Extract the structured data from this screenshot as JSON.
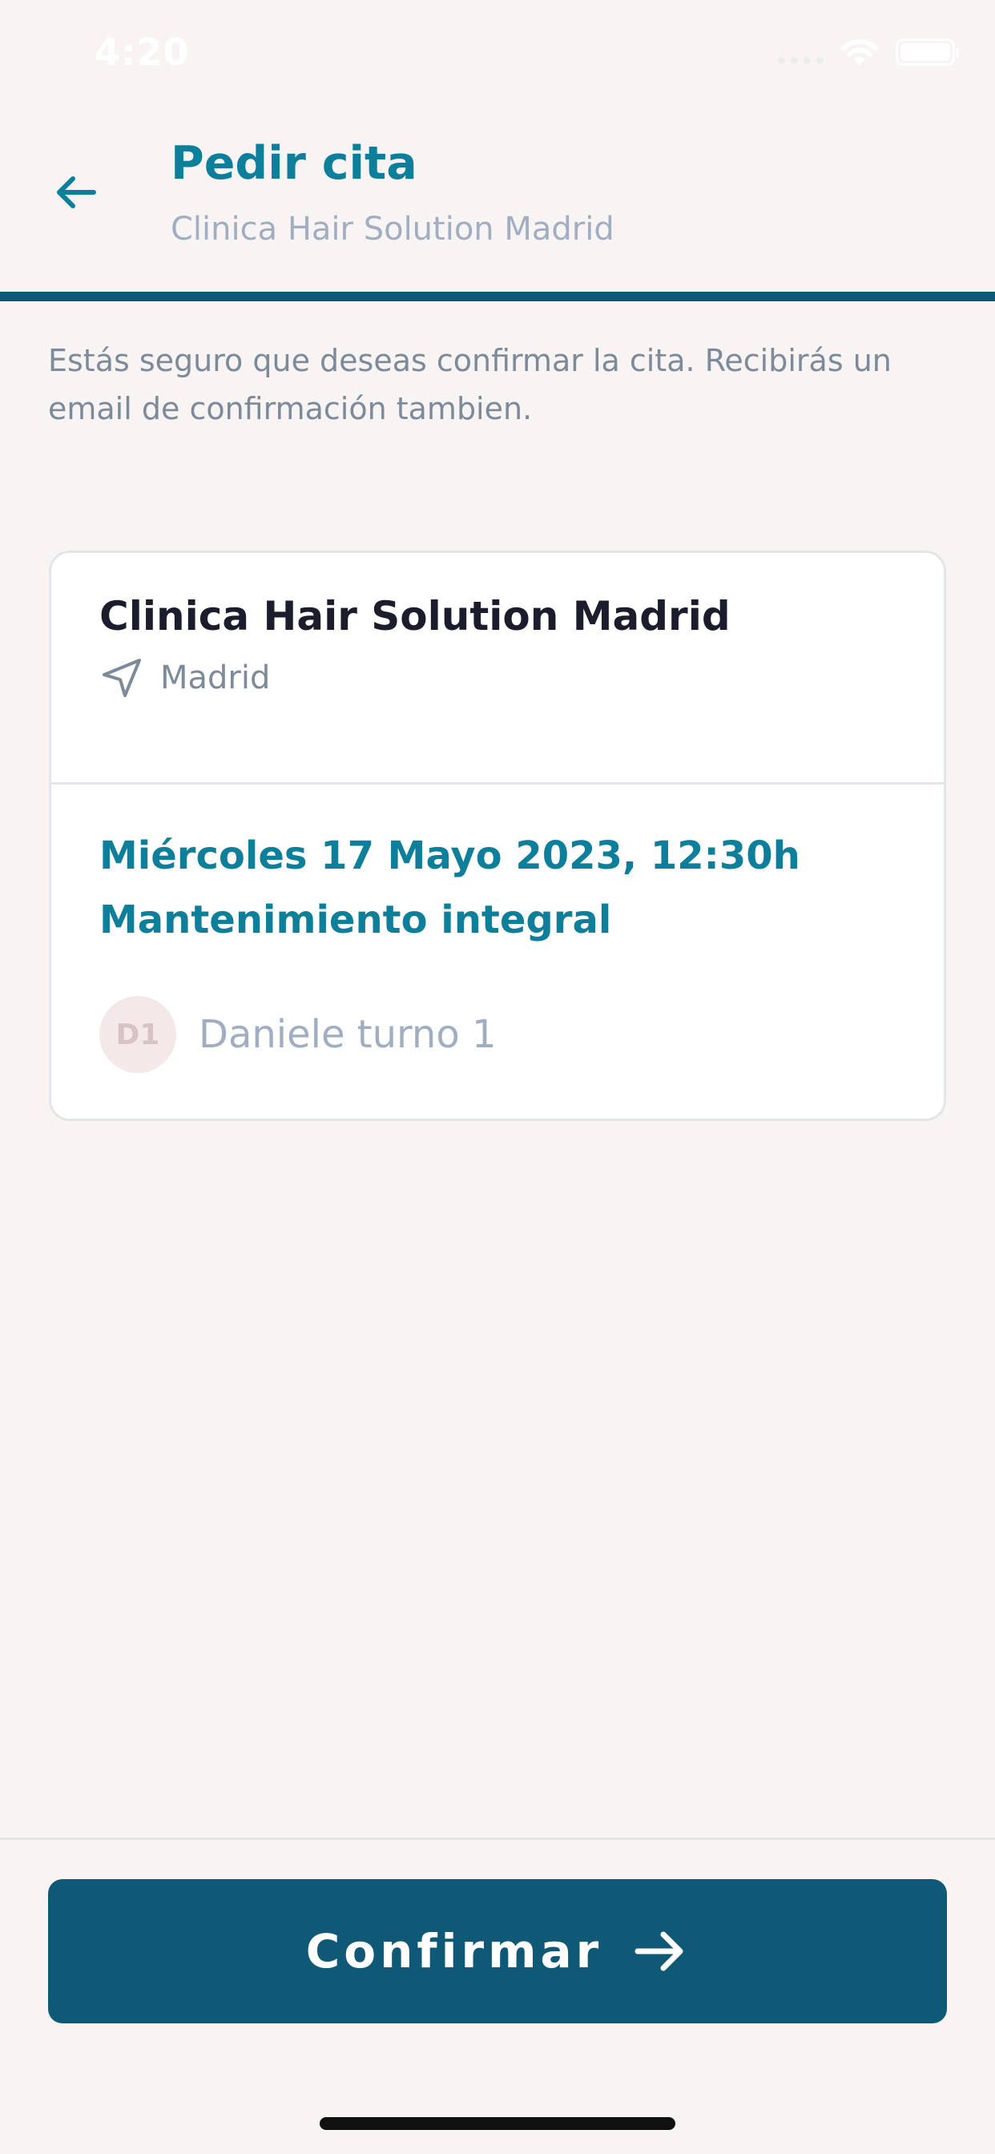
{
  "status_bar": {
    "time": "4:20"
  },
  "header": {
    "title": "Pedir cita",
    "subtitle": "Clinica Hair Solution Madrid"
  },
  "message": "Estás seguro que deseas confirmar la cita. Recibirás un email de confirmación tambien.",
  "card": {
    "clinic_name": "Clinica Hair Solution Madrid",
    "location": "Madrid",
    "date": "Miércoles 17 Mayo 2023, 12:30h",
    "service": "Mantenimiento integral",
    "staff_initials": "D1",
    "staff_name": "Daniele turno 1"
  },
  "footer": {
    "confirm_label": "Confirmar"
  },
  "icons": {
    "back": "arrow-left-icon",
    "location": "navigation-arrow-icon",
    "confirm": "arrow-right-icon",
    "wifi": "wifi-icon",
    "battery": "battery-icon"
  },
  "colors": {
    "accent": "#0e7f9b",
    "primary_dark": "#0f5876",
    "background": "#f7f4f3",
    "muted_text": "#7d8a99"
  }
}
